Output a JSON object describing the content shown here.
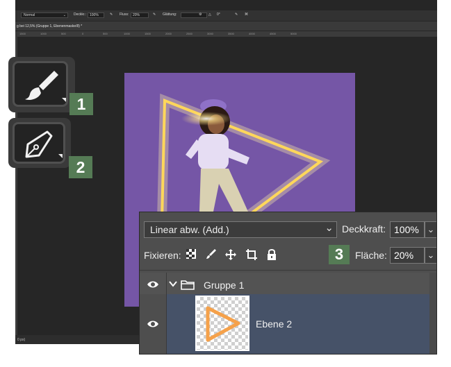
{
  "optionsbar": {
    "mode": "Normal",
    "opacity_label": "Deckkr.:",
    "opacity_value": "100%",
    "flow_label": "Fluss:",
    "flow_value": "20%",
    "smoothing_label": "Glättung:",
    "angle_value": "0°"
  },
  "document_tab": "g bei 12,5% (Gruppe 1, Ebenenmaske/8) *",
  "ruler_ticks": [
    "1500",
    "1000",
    "500",
    "0",
    "500",
    "1000",
    "1500",
    "2000",
    "2500",
    "3000",
    "3500",
    "4000",
    "4500",
    "5000"
  ],
  "statusbar": "0 px)",
  "tools": [
    {
      "name": "Pinsel",
      "badge": "1"
    },
    {
      "name": "Zeichenstift",
      "badge": "2"
    }
  ],
  "layers_panel": {
    "blend_mode": "Linear abw. (Add.)",
    "opacity_label": "Deckkraft:",
    "opacity_value": "100%",
    "lock_label": "Fixieren:",
    "fill_label": "Fläche:",
    "fill_value": "20%",
    "badge": "3",
    "group_name": "Gruppe 1",
    "layer_name": "Ebene 2"
  },
  "colors": {
    "canvas_bg": "#7556a6",
    "neon": "#ffd75a",
    "badge": "#557b55",
    "selected_row": "#465268"
  }
}
